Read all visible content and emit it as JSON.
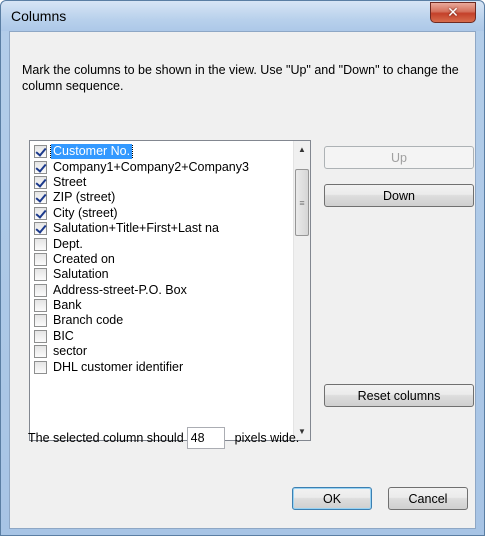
{
  "window": {
    "title": "Columns",
    "close_glyph": "✕"
  },
  "instructions": "Mark the columns to be shown in the view. Use \"Up\" and \"Down\" to change the column sequence.",
  "columns": [
    {
      "label": "Customer No.",
      "checked": true,
      "selected": true
    },
    {
      "label": "Company1+Company2+Company3",
      "checked": true
    },
    {
      "label": "Street",
      "checked": true
    },
    {
      "label": "ZIP (street)",
      "checked": true
    },
    {
      "label": "City (street)",
      "checked": true
    },
    {
      "label": "Salutation+Title+First+Last na",
      "checked": true
    },
    {
      "label": "Dept.",
      "checked": false
    },
    {
      "label": "Created on",
      "checked": false
    },
    {
      "label": "Salutation",
      "checked": false
    },
    {
      "label": "Address-street-P.O. Box",
      "checked": false
    },
    {
      "label": "Bank",
      "checked": false
    },
    {
      "label": "Branch code",
      "checked": false
    },
    {
      "label": "BIC",
      "checked": false
    },
    {
      "label": "sector",
      "checked": false
    },
    {
      "label": "DHL customer identifier",
      "checked": false
    }
  ],
  "buttons": {
    "up": "Up",
    "down": "Down",
    "reset": "Reset columns",
    "ok": "OK",
    "cancel": "Cancel"
  },
  "width_row": {
    "prefix": "The selected column should",
    "value": "48",
    "suffix": "pixels wide."
  },
  "icons": {
    "scroll_up": "scroll-up-arrow-icon",
    "scroll_down": "scroll-down-arrow-icon",
    "close": "close-icon"
  }
}
